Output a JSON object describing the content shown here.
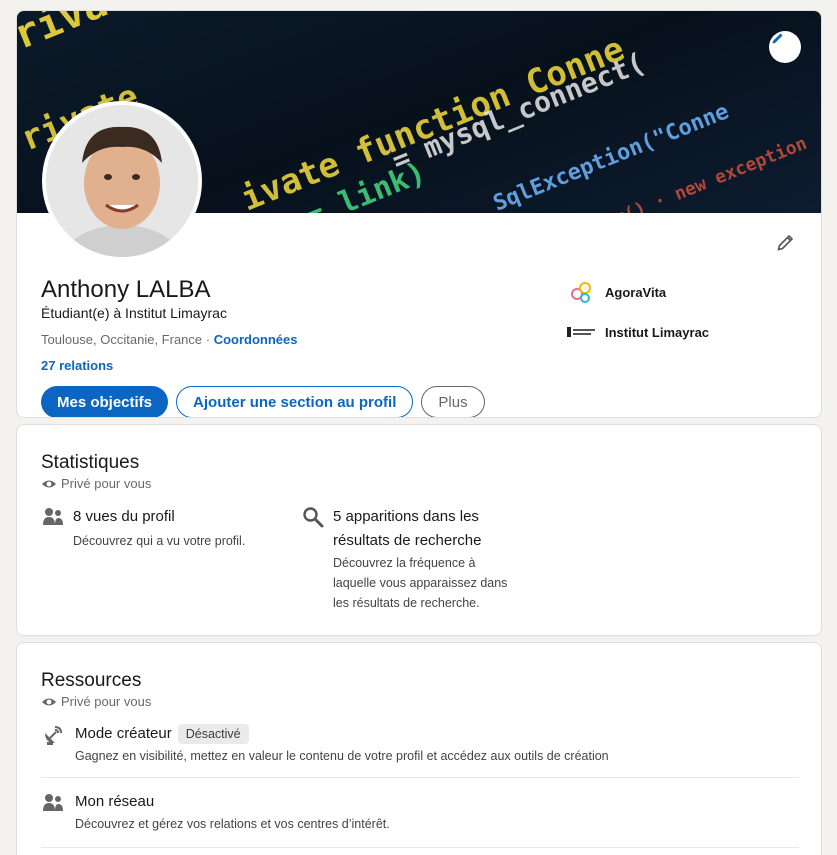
{
  "profile": {
    "name": "Anthony LALBA",
    "headline": "Étudiant(e) à Institut Limayrac",
    "location": "Toulouse, Occitanie, France",
    "separator": " · ",
    "contact_link": "Coordonnées",
    "relations": "27 relations",
    "buttons": {
      "primary": "Mes objectifs",
      "add_section": "Ajouter une section au profil",
      "more": "Plus"
    },
    "organizations": [
      {
        "name": "AgoraVita",
        "icon": "agoravita-logo"
      },
      {
        "name": "Institut Limayrac",
        "icon": "institut-limayrac-logo"
      }
    ],
    "banner_code_lines": [
      "private $cha",
      "private $link = n",
      "ivate function Conne",
      "= mysql_connect(",
      "SqlException(\"Conne",
      "link)"
    ]
  },
  "stats": {
    "title": "Statistiques",
    "private_label": "Privé pour vous",
    "items": [
      {
        "icon": "people-icon",
        "title": "8 vues du profil",
        "desc": [
          "Découvrez qui a vu votre profil."
        ]
      },
      {
        "icon": "search-icon",
        "title_lines": [
          "5 apparitions dans les",
          "résultats de recherche"
        ],
        "desc": [
          "Découvrez la fréquence à",
          "laquelle vous apparaissez dans",
          "les résultats de recherche."
        ]
      }
    ]
  },
  "resources": {
    "title": "Ressources",
    "private_label": "Privé pour vous",
    "items": [
      {
        "icon": "satellite-dish-icon",
        "title": "Mode créateur",
        "badge": "Désactivé",
        "desc": "Gagnez en visibilité, mettez en valeur le contenu de votre profil et accédez aux outils de création"
      },
      {
        "icon": "people-icon",
        "title": "Mon réseau",
        "desc": "Découvrez et gérez vos relations et vos centres d’intérêt."
      }
    ]
  },
  "colors": {
    "accent": "#0a66c2",
    "background": "#f4f2ee",
    "card": "#ffffff"
  }
}
